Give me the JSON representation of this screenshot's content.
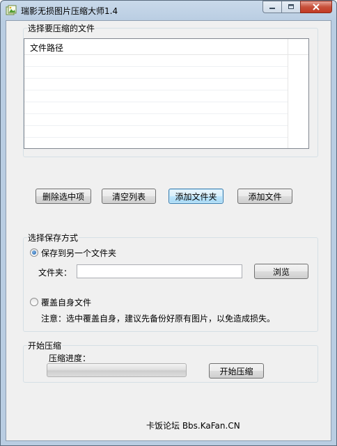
{
  "window": {
    "title": "瑞影无损图片压缩大师1.4"
  },
  "file_group": {
    "label": "选择要压缩的文件",
    "list_column": "文件路径",
    "rows": []
  },
  "buttons": {
    "delete_selected": "删除选中项",
    "clear_list": "清空列表",
    "add_folder": "添加文件夹",
    "add_file": "添加文件",
    "browse": "浏览",
    "start": "开始压缩"
  },
  "save_group": {
    "label": "选择保存方式",
    "option_other_folder": "保存到另一个文件夹",
    "option_other_folder_selected": true,
    "folder_label": "文件夹：",
    "folder_value": "",
    "option_overwrite": "覆盖自身文件",
    "option_overwrite_selected": false,
    "note": "注意：选中覆盖自身，建议先备份好原有图片，以免造成损失。"
  },
  "start_group": {
    "label": "开始压缩",
    "progress_label": "压缩进度：",
    "progress_fraction": 0
  },
  "footer": {
    "text": "卡饭论坛 Bbs.KaFan.CN"
  },
  "colors": {
    "title_bg": "#b9cde2",
    "client_bg": "#f0f0f0",
    "close_button": "#c7503a",
    "focus_border": "#3c7fb1"
  },
  "icons": {
    "app": "image-app-icon",
    "minimize": "minimize-icon",
    "maximize": "maximize-icon",
    "close": "close-icon"
  }
}
